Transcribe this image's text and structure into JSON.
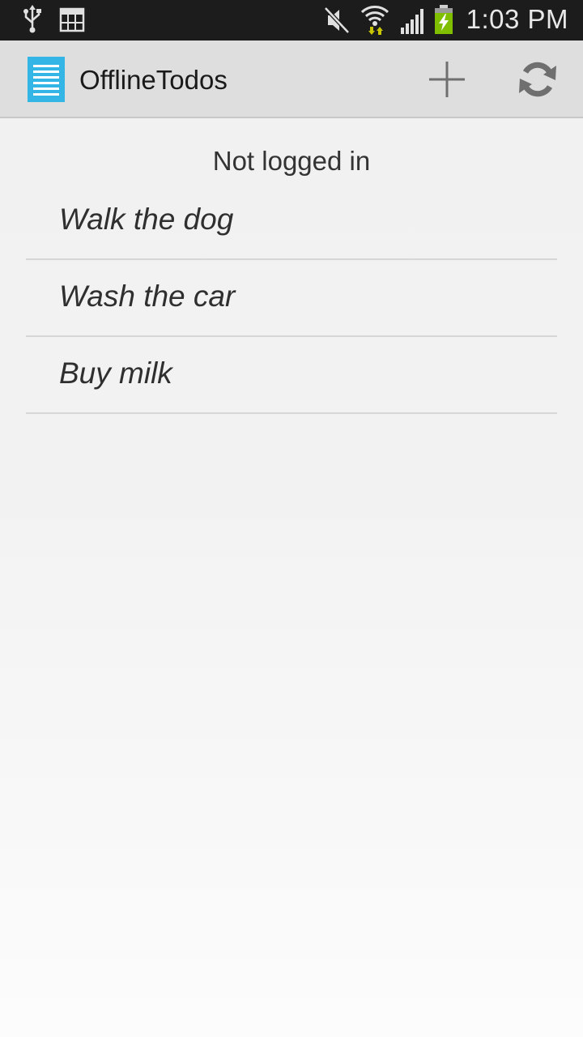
{
  "status_bar": {
    "time": "1:03 PM",
    "icons": [
      "usb-icon",
      "gallery-icon",
      "mute-icon",
      "wifi-icon",
      "signal-icon",
      "battery-charging-icon"
    ]
  },
  "action_bar": {
    "title": "OfflineTodos",
    "app_icon": "list-document-icon",
    "actions": [
      "add-icon",
      "refresh-icon"
    ]
  },
  "content": {
    "login_status": "Not logged in",
    "todos": [
      {
        "title": "Walk the dog"
      },
      {
        "title": "Wash the car"
      },
      {
        "title": "Buy milk"
      }
    ]
  },
  "colors": {
    "status_bar_bg": "#1c1c1c",
    "action_bar_bg": "#dedede",
    "app_icon_blue": "#33b5e5",
    "battery_green": "#7fbf00",
    "wifi_arrows": "#c9c400"
  }
}
